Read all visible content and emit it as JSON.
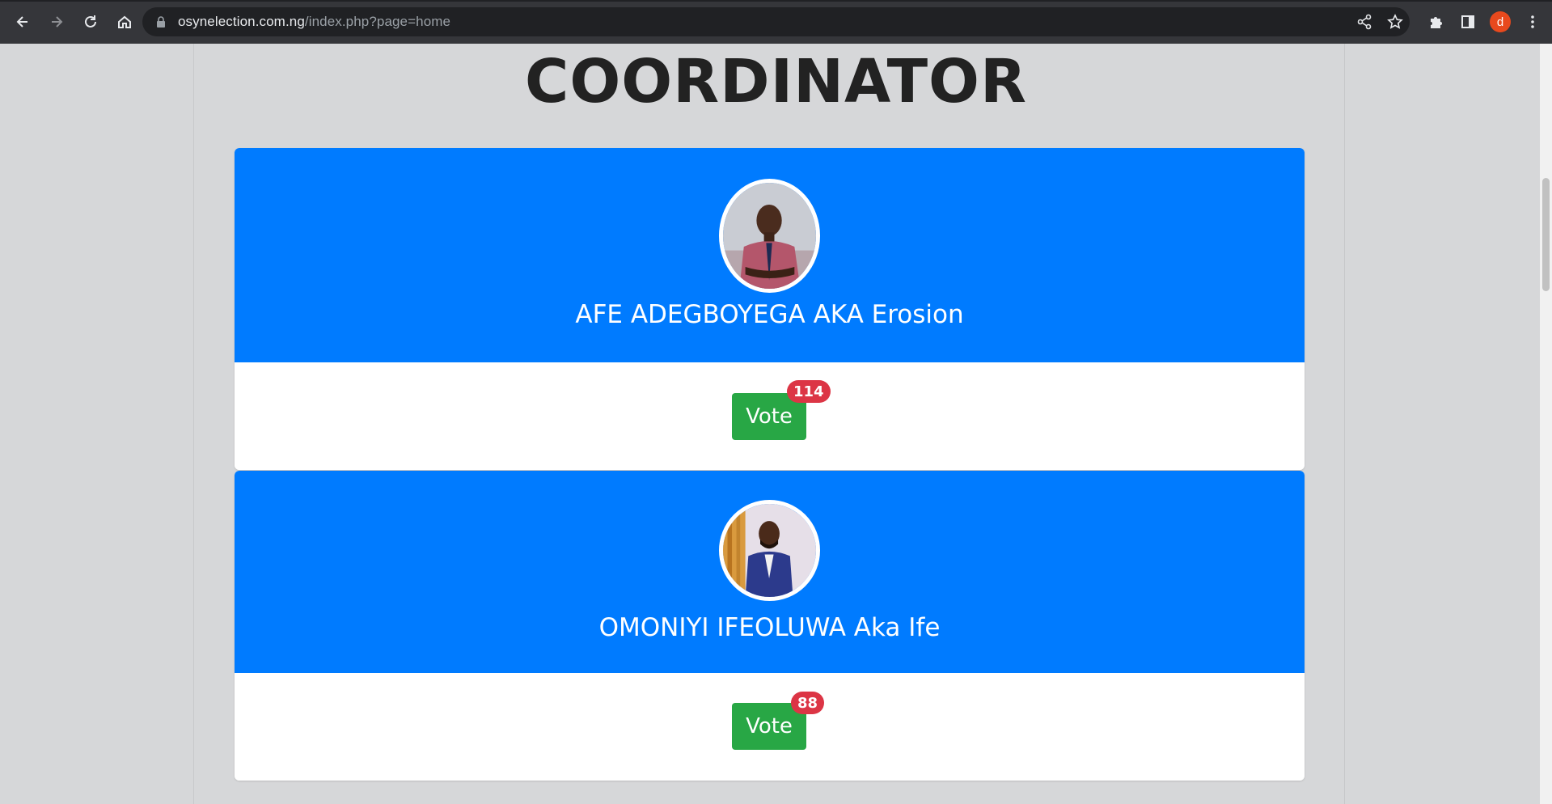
{
  "browser": {
    "url_domain": "osynelection.com.ng",
    "url_path": "/index.php?page=home",
    "profile_initial": "d"
  },
  "page": {
    "section_title": "COORDINATOR"
  },
  "candidates": [
    {
      "name": "AFE ADEGBOYEGA AKA Erosion",
      "vote_label": "Vote",
      "votes": "114"
    },
    {
      "name": "OMONIYI IFEOLUWA Aka Ife",
      "vote_label": "Vote",
      "votes": "88"
    }
  ],
  "colors": {
    "card_header": "#007bff",
    "vote_button": "#28a745",
    "badge": "#dc3545"
  }
}
